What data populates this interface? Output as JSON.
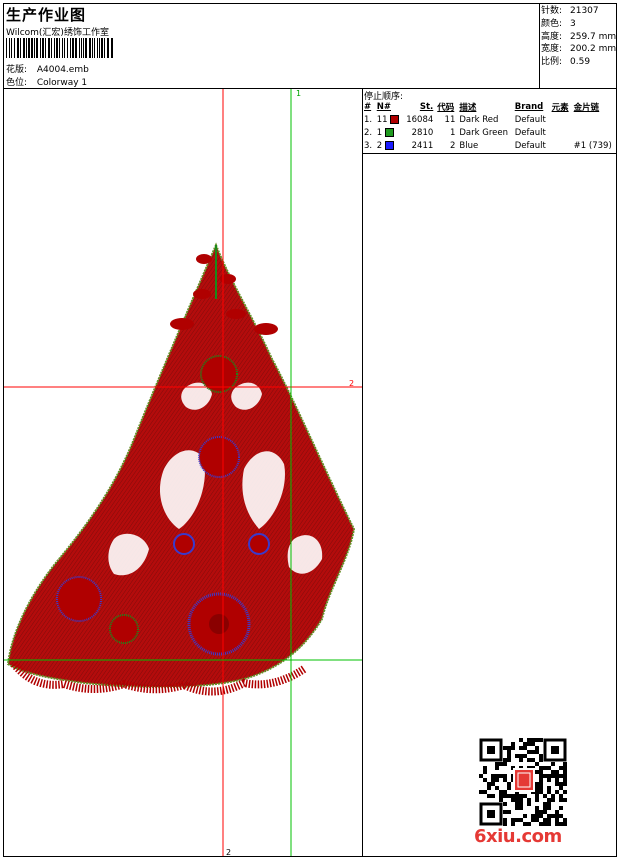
{
  "header": {
    "title": "生产作业图",
    "company": "Wilcom(汇宏)绣饰工作室",
    "file_label": "花版:",
    "file_value": "A4004.emb",
    "colorway_label": "色位:",
    "colorway_value": "Colorway 1"
  },
  "specs": [
    {
      "label": "针数:",
      "value": "21307"
    },
    {
      "label": "颜色:",
      "value": "3"
    },
    {
      "label": "高度:",
      "value": "259.7 mm"
    },
    {
      "label": "宽度:",
      "value": "200.2 mm"
    },
    {
      "label": "比例:",
      "value": "0.59"
    }
  ],
  "stop_sequence": {
    "title": "停止顺序:",
    "headers": [
      "#",
      "N#",
      "St.",
      "代码",
      "描述",
      "Brand",
      "元素",
      "金片链"
    ],
    "rows": [
      {
        "idx": "1.",
        "n": "11",
        "color": "#b00000",
        "st": "16084",
        "code": "11",
        "desc": "Dark Red",
        "brand": "Default",
        "elem": "",
        "seq": ""
      },
      {
        "idx": "2.",
        "n": "1",
        "color": "#1f9a1f",
        "st": "2810",
        "code": "1",
        "desc": "Dark Green",
        "brand": "Default",
        "elem": "",
        "seq": ""
      },
      {
        "idx": "3.",
        "n": "2",
        "color": "#1a1aff",
        "st": "2411",
        "code": "2",
        "desc": "Blue",
        "brand": "Default",
        "elem": "",
        "seq": "#1 (739)"
      }
    ]
  },
  "guides": {
    "label_green_top": "1",
    "label_red_right": "2",
    "label_red_bottom": "2"
  },
  "colors": {
    "dark_red": "#b00000",
    "dark_green": "#1f9a1f",
    "blue": "#1a1aff",
    "guide_red": "#ff0000",
    "guide_green": "#00c000"
  },
  "watermark": "6xiu.com"
}
